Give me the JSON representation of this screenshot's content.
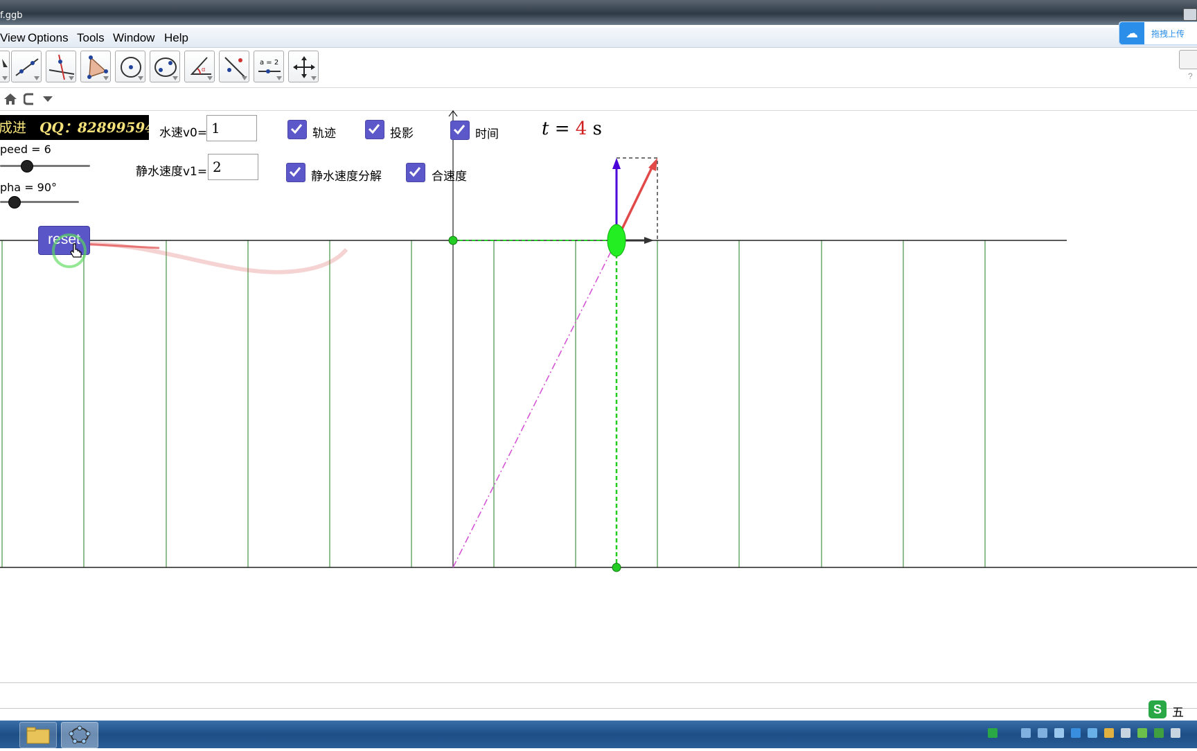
{
  "window": {
    "title": "f.ggb"
  },
  "menu": {
    "items": [
      "View",
      "Options",
      "Tools",
      "Window",
      "Help"
    ]
  },
  "upload_widget": {
    "label": "拖拽上传",
    "icon": "cloud-icon"
  },
  "toolbar": {
    "tools": [
      {
        "name": "move-tool",
        "icon": "arrow-icon"
      },
      {
        "name": "line-tool",
        "icon": "line-through-points-icon"
      },
      {
        "name": "perpendicular-tool",
        "icon": "perpendicular-line-icon"
      },
      {
        "name": "polygon-tool",
        "icon": "polygon-icon"
      },
      {
        "name": "circle-tool",
        "icon": "circle-center-point-icon"
      },
      {
        "name": "conic-tool",
        "icon": "ellipse-icon"
      },
      {
        "name": "angle-tool",
        "icon": "angle-icon"
      },
      {
        "name": "reflect-tool",
        "icon": "reflect-icon"
      },
      {
        "name": "slider-tool",
        "icon": "slider-icon",
        "label": "a = 2"
      },
      {
        "name": "move-graphics-tool",
        "icon": "move-cross-icon"
      }
    ]
  },
  "navbar": {
    "icons": [
      "home-icon",
      "graphics-view-icon",
      "dropdown-icon"
    ]
  },
  "banner": {
    "left_text": "成进",
    "qq_text": "QQ：82899594"
  },
  "sliders": [
    {
      "label": "peed = 6",
      "value": 6
    },
    {
      "label": "pha = 90°",
      "value": 90
    }
  ],
  "inputs": {
    "v0": {
      "label": "水速v0=",
      "value": "1"
    },
    "v1": {
      "label": "静水速度v1=",
      "value": "2"
    }
  },
  "checkboxes": [
    {
      "label": "轨迹",
      "checked": true
    },
    {
      "label": "投影",
      "checked": true
    },
    {
      "label": "时间",
      "checked": true
    },
    {
      "label": "静水速度分解",
      "checked": true
    },
    {
      "label": "合速度",
      "checked": true
    }
  ],
  "time_display": {
    "var": "t",
    "eq": " = ",
    "value": "4",
    "unit": " s"
  },
  "reset_button": {
    "label": "reset"
  },
  "colors": {
    "accent": "#5d58c9",
    "river_lines": "#8fbf8f",
    "point_green": "#22cc22",
    "trajectory_magenta": "#d555d5",
    "velocity_red": "#e24a4a",
    "velocity_blue": "#4b00d9",
    "time_value": "#d02020"
  },
  "ime": {
    "label": "五"
  }
}
